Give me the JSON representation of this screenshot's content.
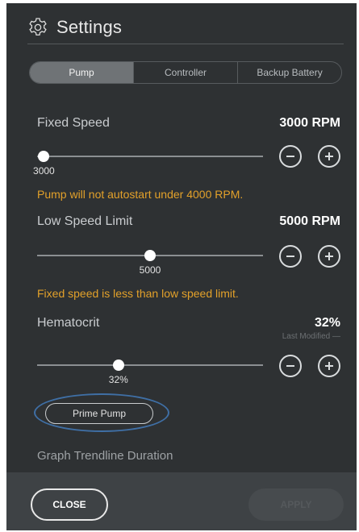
{
  "header": {
    "title": "Settings",
    "icon": "gear-icon"
  },
  "tabs": [
    {
      "label": "Pump",
      "active": true
    },
    {
      "label": "Controller",
      "active": false
    },
    {
      "label": "Backup Battery",
      "active": false
    }
  ],
  "fixed_speed": {
    "label": "Fixed Speed",
    "value": "3000 RPM",
    "slider_value": "3000",
    "slider_fraction": 0.03,
    "warning": "Pump will not autostart under 4000 RPM."
  },
  "low_speed_limit": {
    "label": "Low Speed Limit",
    "value": "5000 RPM",
    "slider_value": "5000",
    "slider_fraction": 0.5,
    "warning": "Fixed speed is less than low speed limit."
  },
  "hematocrit": {
    "label": "Hematocrit",
    "value": "32%",
    "last_modified": "Last Modified —",
    "slider_value": "32%",
    "slider_fraction": 0.36
  },
  "prime_pump": {
    "label": "Prime Pump"
  },
  "graph_trendline": {
    "label": "Graph Trendline Duration"
  },
  "footer": {
    "close_label": "CLOSE",
    "apply_label": "APPLY",
    "apply_enabled": false
  },
  "colors": {
    "background": "#2e3133",
    "footer": "#3e4245",
    "warning": "#e3a12a",
    "focus_ring": "#3f6fa5"
  }
}
